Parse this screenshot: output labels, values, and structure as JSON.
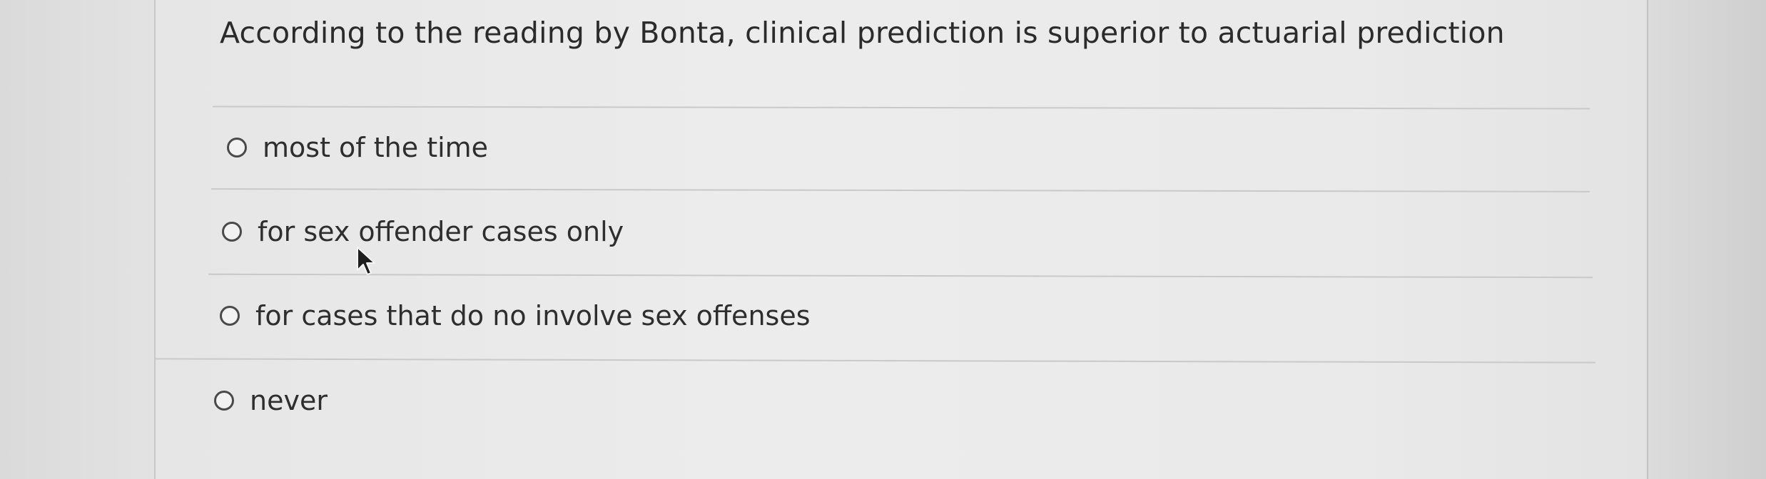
{
  "question": {
    "text": "According to the reading by Bonta, clinical prediction is superior to actuarial prediction"
  },
  "options": [
    {
      "label": "most of the time",
      "selected": false
    },
    {
      "label": "for sex offender cases only",
      "selected": false
    },
    {
      "label": "for cases that do no involve sex offenses",
      "selected": false
    },
    {
      "label": "never",
      "selected": false
    }
  ],
  "colors": {
    "text": "#2b2b2b",
    "radio_border": "#4a4a4a",
    "divider": "#c9c9c9",
    "panel_bg": "#ebebeb"
  },
  "icons": {
    "cursor": "mouse-pointer-icon"
  }
}
